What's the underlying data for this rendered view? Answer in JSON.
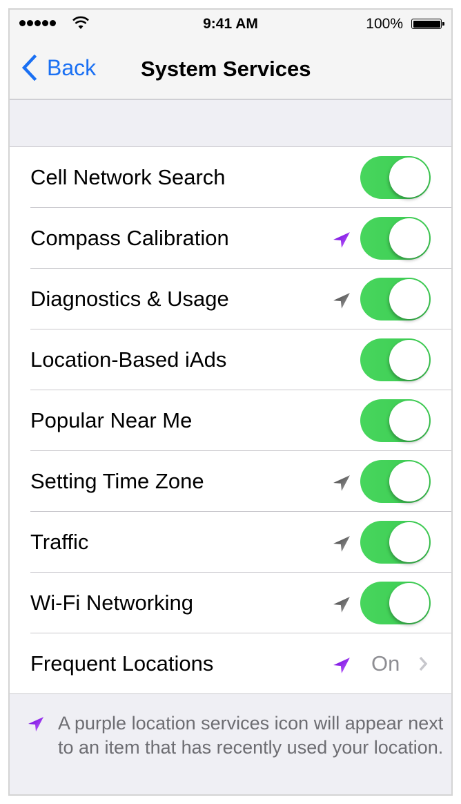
{
  "status_bar": {
    "signal_bars": 5,
    "wifi_icon": "wifi-icon",
    "time": "9:41 AM",
    "battery_percent": "100%",
    "battery_level": 1.0
  },
  "nav": {
    "back_label": "Back",
    "title": "System Services"
  },
  "colors": {
    "accent": "#1a70f3",
    "toggle_on": "#4cd964",
    "location_recent": "#8b1df0",
    "location_used": "#6e6e6e",
    "secondary_text": "#8e8e93",
    "group_background": "#efeff4"
  },
  "services": [
    {
      "label": "Cell Network Search",
      "location_icon": "none",
      "control": "toggle",
      "on": true
    },
    {
      "label": "Compass Calibration",
      "location_icon": "purple",
      "control": "toggle",
      "on": true
    },
    {
      "label": "Diagnostics & Usage",
      "location_icon": "gray",
      "control": "toggle",
      "on": true
    },
    {
      "label": "Location-Based iAds",
      "location_icon": "none",
      "control": "toggle",
      "on": true
    },
    {
      "label": "Popular Near Me",
      "location_icon": "none",
      "control": "toggle",
      "on": true
    },
    {
      "label": "Setting Time Zone",
      "location_icon": "gray",
      "control": "toggle",
      "on": true
    },
    {
      "label": "Traffic",
      "location_icon": "gray",
      "control": "toggle",
      "on": true
    },
    {
      "label": "Wi-Fi Networking",
      "location_icon": "gray",
      "control": "toggle",
      "on": true
    },
    {
      "label": "Frequent Locations",
      "location_icon": "purple",
      "control": "disclosure",
      "value": "On"
    }
  ],
  "footer": {
    "icon": "location-arrow-purple-icon",
    "text": "A purple location services icon will appear next to an item that has recently used your location."
  }
}
